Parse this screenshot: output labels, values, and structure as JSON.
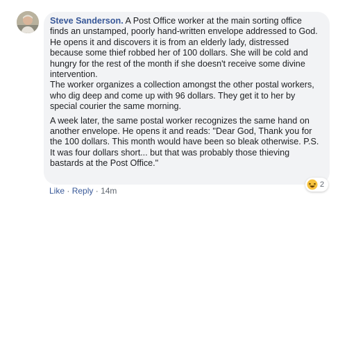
{
  "comment": {
    "author": "Steve Sanderson.",
    "paragraph1": "A Post Office worker at the main sorting office finds an unstamped, poorly hand-written envelope addressed to God. He opens it and discovers it is from an elderly lady, distressed because some thief robbed her of 100 dollars. She will be cold and hungry for the rest of the month if she doesn't receive some divine intervention.\nThe worker organizes a collection amongst the other postal workers, who dig deep and come up with 96 dollars. They get it to her by special courier the same morning.",
    "paragraph2": "A week later, the same postal worker recognizes the same hand on another envelope. He opens it and reads: \"Dear God, Thank you for the 100 dollars. This month would have been so bleak otherwise. P.S. It was four dollars short... but that was probably those thieving bastards at the Post Office.\""
  },
  "reactions": {
    "icon": "laughing-emoji-icon",
    "count": "2"
  },
  "actions": {
    "like": "Like",
    "separator": "·",
    "reply": "Reply",
    "time": "14m"
  },
  "colors": {
    "author": "#385898",
    "bubble": "#f2f3f5",
    "text": "#1c1e21",
    "meta": "#606770"
  }
}
